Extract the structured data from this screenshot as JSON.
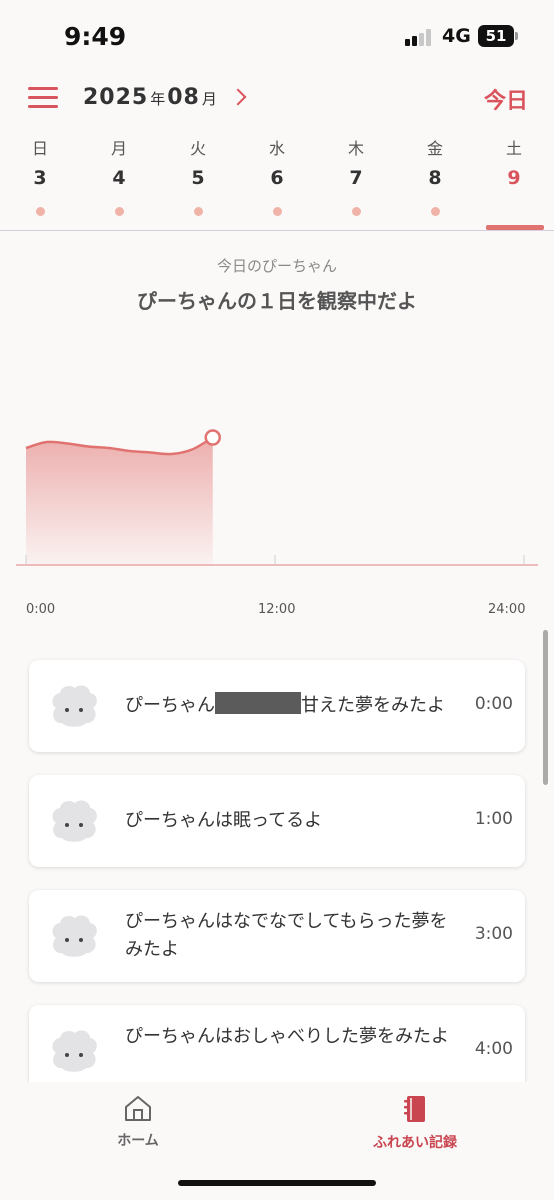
{
  "status_bar": {
    "time": "9:49",
    "network": "4G",
    "battery": "51"
  },
  "header": {
    "year": "2025",
    "year_unit": "年",
    "month": "08",
    "month_unit": "月",
    "today_label": "今日"
  },
  "week": [
    {
      "dow": "日",
      "date": "3"
    },
    {
      "dow": "月",
      "date": "4"
    },
    {
      "dow": "火",
      "date": "5"
    },
    {
      "dow": "水",
      "date": "6"
    },
    {
      "dow": "木",
      "date": "7"
    },
    {
      "dow": "金",
      "date": "8"
    },
    {
      "dow": "土",
      "date": "9"
    }
  ],
  "selected_day": "9",
  "observation": {
    "subtitle": "今日のぴーちゃん",
    "title": "ぴーちゃんの１日を観察中だよ"
  },
  "chart_data": {
    "type": "area",
    "x_ticks": [
      "0:00",
      "12:00",
      "24:00"
    ],
    "xlim": [
      0,
      24
    ],
    "x": [
      0,
      1,
      2,
      3,
      4,
      5,
      6,
      7,
      8,
      9
    ],
    "values": [
      0.78,
      0.82,
      0.81,
      0.79,
      0.78,
      0.76,
      0.75,
      0.74,
      0.77,
      0.85
    ],
    "ylim": [
      0,
      1.5
    ],
    "color": "#e07270"
  },
  "records": [
    {
      "text_before": "ぴーちゃん",
      "text_after": "甘えた夢をみたよ",
      "redacted": true,
      "time": "0:00"
    },
    {
      "text_before": "ぴーちゃんは眠ってるよ",
      "text_after": "",
      "redacted": false,
      "time": "1:00"
    },
    {
      "text_before": "ぴーちゃんはなでなでしてもらった夢をみたよ",
      "text_after": "",
      "redacted": false,
      "time": "3:00"
    },
    {
      "text_before": "ぴーちゃんはおしゃべりした夢をみたよ",
      "text_after": "",
      "redacted": false,
      "time": "4:00"
    }
  ],
  "tabs": {
    "home": "ホーム",
    "records": "ふれあい記録"
  },
  "colors": {
    "accent": "#d9545c",
    "dot": "#efb3a8",
    "chart": "#e07270"
  }
}
